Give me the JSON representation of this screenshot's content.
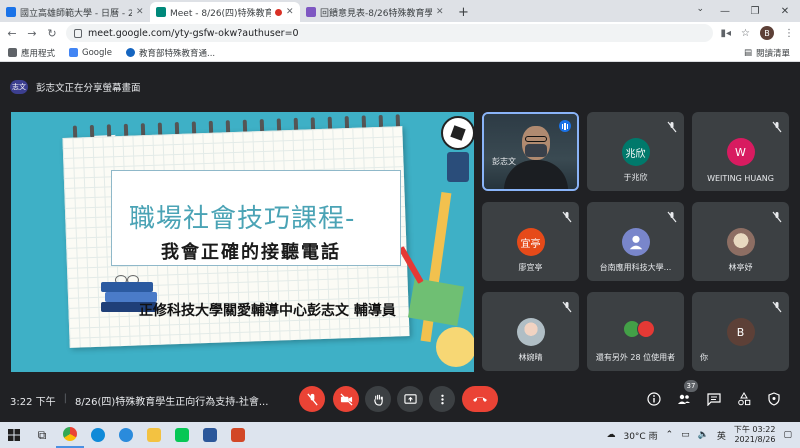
{
  "browser": {
    "tabs": [
      {
        "title": "國立高雄師範大學 - 日曆 - 2021年",
        "active": false,
        "color": "#1a73e8"
      },
      {
        "title": "Meet - 8/26(四)特殊教育學生",
        "active": true,
        "color": "#00897b",
        "recording": true
      },
      {
        "title": "回饋意見表-8/26特殊教育學生正向",
        "active": false,
        "color": "#7e57c2"
      }
    ],
    "url": "meet.google.com/yty-gsfw-okw?authuser=0",
    "profile_initial": "B",
    "bookmarks": [
      {
        "label": "應用程式",
        "color": "#5f6368"
      },
      {
        "label": "Google",
        "color": "#4285f4"
      },
      {
        "label": "教育部特殊教育通...",
        "color": "#1565c0"
      }
    ],
    "reading_list": "閱讀清單"
  },
  "meet": {
    "presenting_banner": "彭志文正在分享螢幕畫面",
    "presenter_initials": "志文",
    "slide": {
      "title": "職場社會技巧課程-",
      "subtitle": "我會正確的接聽電話",
      "presenter_line": "正修科技大學關愛輔導中心彭志文 輔導員"
    },
    "participants": [
      {
        "name": "彭志文",
        "type": "video",
        "speaking": true
      },
      {
        "name": "于兆欣",
        "initials": "兆欣",
        "color": "#00796b"
      },
      {
        "name": "WEITING HUANG",
        "initials": "W",
        "color": "#d81b60"
      },
      {
        "name": "廖宜亭",
        "initials": "宜亭",
        "color": "#e64a19"
      },
      {
        "name": "台南應用科技大學...",
        "initials": "",
        "color": "#7986cb"
      },
      {
        "name": "林亭妤",
        "initials": "",
        "color": "#8d6e63"
      },
      {
        "name": "林婉晴",
        "initials": "",
        "color": "#b0bec5"
      },
      {
        "name": "還有另外 28 位使用者",
        "initials": "",
        "color": "#43a047"
      },
      {
        "name": "你",
        "initials": "B",
        "color": "#5d4037"
      }
    ],
    "time": "3:22 下午",
    "meeting_title": "8/26(四)特殊教育學生正向行為支持-社會...",
    "participant_count": "37"
  },
  "taskbar": {
    "weather": "30°C 雨",
    "ime": "英",
    "time": "下午 03:22",
    "date": "2021/8/26"
  }
}
